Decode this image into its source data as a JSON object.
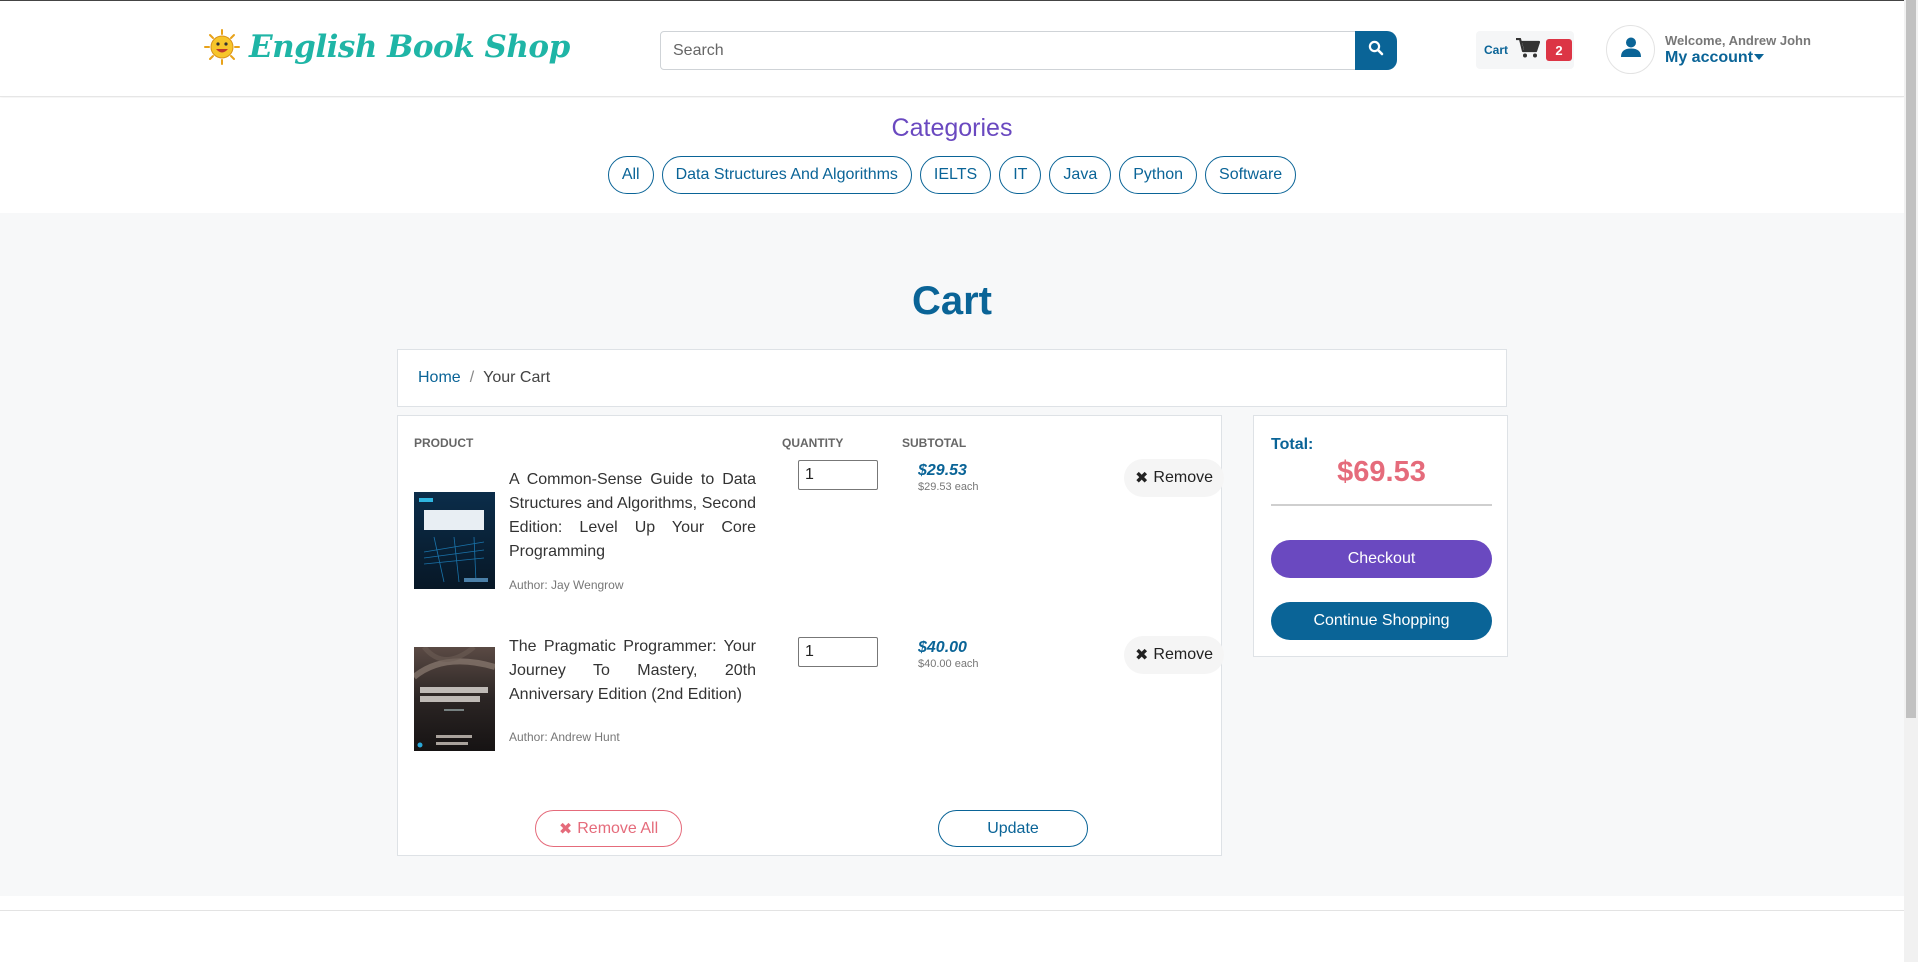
{
  "header": {
    "logo_text": "English Book Shop",
    "search": {
      "placeholder": "Search",
      "value": ""
    },
    "cart": {
      "label": "Cart",
      "count": "2"
    },
    "account": {
      "welcome": "Welcome, Andrew John",
      "menu_label": "My account"
    }
  },
  "categories": {
    "title": "Categories",
    "items": [
      "All",
      "Data Structures And Algorithms",
      "IELTS",
      "IT",
      "Java",
      "Python",
      "Software"
    ]
  },
  "page": {
    "title": "Cart",
    "breadcrumb": {
      "home": "Home",
      "separator": "/",
      "current": "Your Cart"
    }
  },
  "cart_table": {
    "headers": {
      "product": "PRODUCT",
      "quantity": "QUANTITY",
      "subtotal": "SUBTOTAL"
    },
    "items": [
      {
        "title": "A Common-Sense Guide to Data Structures and Algorithms, Second Edition: Level Up Your Core Programming",
        "author": "Author: Jay Wengrow",
        "quantity": "1",
        "subtotal": "$29.53",
        "each": "$29.53 each",
        "remove_label": "Remove"
      },
      {
        "title": "The Pragmatic Programmer: Your Journey To Mastery, 20th Anniversary Edition (2nd Edition)",
        "author": "Author: Andrew Hunt",
        "quantity": "1",
        "subtotal": "$40.00",
        "each": "$40.00 each",
        "remove_label": "Remove"
      }
    ],
    "remove_all_label": "Remove All",
    "update_label": "Update"
  },
  "summary": {
    "total_label": "Total:",
    "total_value": "$69.53",
    "checkout_label": "Checkout",
    "continue_label": "Continue Shopping"
  },
  "colors": {
    "primary": "#0a6497",
    "purple": "#6a49c0",
    "accent_red": "#e56b7b",
    "badge": "#dc3545",
    "logo": "#1fb5a6"
  }
}
